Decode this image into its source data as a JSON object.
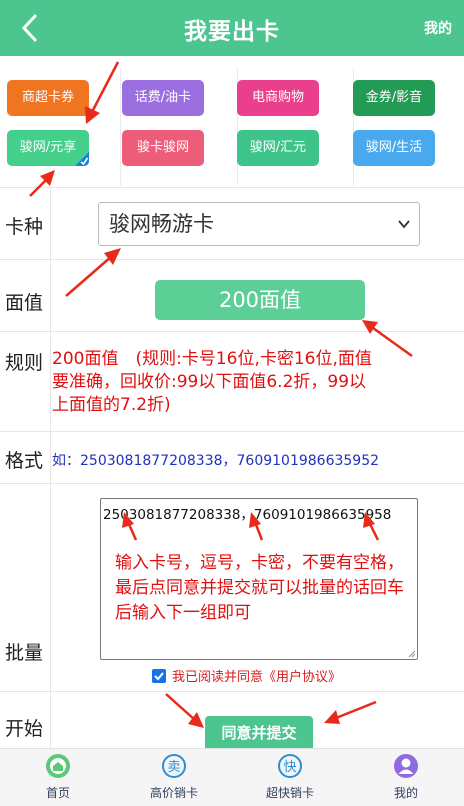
{
  "header": {
    "title": "我要出卡",
    "mine_label": "我的"
  },
  "categories": [
    {
      "label": "商超卡券",
      "color": "#f07521"
    },
    {
      "label": "话费/油卡",
      "color": "#9b6fe0"
    },
    {
      "label": "电商购物",
      "color": "#ea3f8d"
    },
    {
      "label": "金券/影音",
      "color": "#239b55"
    },
    {
      "label": "骏网/元享",
      "color": "#44cf8a"
    },
    {
      "label": "骏卡骏网",
      "color": "#ec5d7a"
    },
    {
      "label": "骏网/汇元",
      "color": "#3ec48a"
    },
    {
      "label": "骏网/生活",
      "color": "#49a9ef"
    }
  ],
  "form": {
    "card_type_label": "卡种",
    "card_type_value": "骏网畅游卡",
    "face_label": "面值",
    "face_value": "200面值",
    "rule_label": "规则",
    "rule_text": "200面值　(规则:卡号16位,卡密16位,面值要准确，回收价:99以下面值6.2折，99以上面值的7.2折)",
    "format_label": "格式",
    "format_text": "如：2503081877208338，7609101986635952",
    "batch_label": "批量",
    "batch_value": "2503081877208338，7609101986635958",
    "batch_hint": "输入卡号，逗号，卡密，不要有空格，最后点同意并提交就可以批量的话回车后输入下一组即可",
    "agree_prefix": "我已阅读并同意",
    "agree_link": "《用户协议》",
    "start_label": "开始",
    "submit_label": "同意并提交"
  },
  "nav": [
    {
      "label": "首页",
      "icon": "home-icon",
      "color": "#5cc878"
    },
    {
      "label": "高价销卡",
      "icon": "sell-icon",
      "color": "#2b8fd6"
    },
    {
      "label": "超快销卡",
      "icon": "fast-icon",
      "color": "#2b8fd6"
    },
    {
      "label": "我的",
      "icon": "user-icon",
      "color": "#8f6ae0"
    }
  ]
}
